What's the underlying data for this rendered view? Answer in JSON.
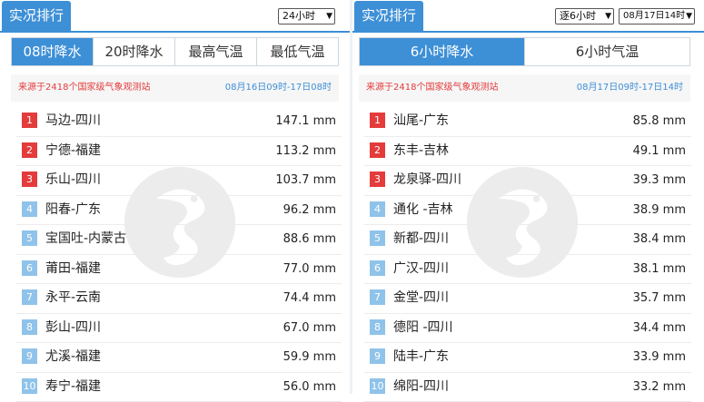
{
  "left": {
    "title": "实况排行",
    "period_select": "24小时",
    "tabs": [
      {
        "label": "08时降水",
        "active": true
      },
      {
        "label": "20时降水",
        "active": false
      },
      {
        "label": "最高气温",
        "active": false
      },
      {
        "label": "最低气温",
        "active": false
      }
    ],
    "source_text": "来源于2418个国家级气象观测站",
    "time_range": "08月16日09时-17日08时",
    "rows": [
      {
        "rank": "1",
        "station": "马边-四川",
        "value": "147.1 mm"
      },
      {
        "rank": "2",
        "station": "宁德-福建",
        "value": "113.2 mm"
      },
      {
        "rank": "3",
        "station": "乐山-四川",
        "value": "103.7 mm"
      },
      {
        "rank": "4",
        "station": "阳春-广东",
        "value": "96.2 mm"
      },
      {
        "rank": "5",
        "station": "宝国吐-内蒙古",
        "value": "88.6 mm"
      },
      {
        "rank": "6",
        "station": "莆田-福建",
        "value": "77.0 mm"
      },
      {
        "rank": "7",
        "station": "永平-云南",
        "value": "74.4 mm"
      },
      {
        "rank": "8",
        "station": "彭山-四川",
        "value": "67.0 mm"
      },
      {
        "rank": "9",
        "station": "尤溪-福建",
        "value": "59.9 mm"
      },
      {
        "rank": "10",
        "station": "寿宁-福建",
        "value": "56.0 mm"
      }
    ]
  },
  "right": {
    "title": "实况排行",
    "interval_select": "逐6小时",
    "time_select": "08月17日14时",
    "tabs": [
      {
        "label": "6小时降水",
        "active": true
      },
      {
        "label": "6小时气温",
        "active": false
      }
    ],
    "source_text": "来源于2418个国家级气象观测站",
    "time_range": "08月17日09时-17日14时",
    "rows": [
      {
        "rank": "1",
        "station": "汕尾-广东",
        "value": "85.8 mm"
      },
      {
        "rank": "2",
        "station": "东丰-吉林",
        "value": "49.1 mm"
      },
      {
        "rank": "3",
        "station": "龙泉驿-四川",
        "value": "39.3 mm"
      },
      {
        "rank": "4",
        "station": "通化 -吉林",
        "value": "38.9 mm"
      },
      {
        "rank": "5",
        "station": "新都-四川",
        "value": "38.4 mm"
      },
      {
        "rank": "6",
        "station": "广汉-四川",
        "value": "38.1 mm"
      },
      {
        "rank": "7",
        "station": "金堂-四川",
        "value": "35.7 mm"
      },
      {
        "rank": "8",
        "station": "德阳 -四川",
        "value": "34.4 mm"
      },
      {
        "rank": "9",
        "station": "陆丰-广东",
        "value": "33.9 mm"
      },
      {
        "rank": "10",
        "station": "绵阳-四川",
        "value": "33.2 mm"
      }
    ]
  },
  "colors": {
    "accent": "#3d8fd6",
    "rank_top": "#e43b3b",
    "rank_other": "#8fc3ea",
    "source_text": "#e43b3b"
  },
  "icons": {
    "watermark": "dragon-logo-icon",
    "dropdown": "chevron-down-icon"
  }
}
